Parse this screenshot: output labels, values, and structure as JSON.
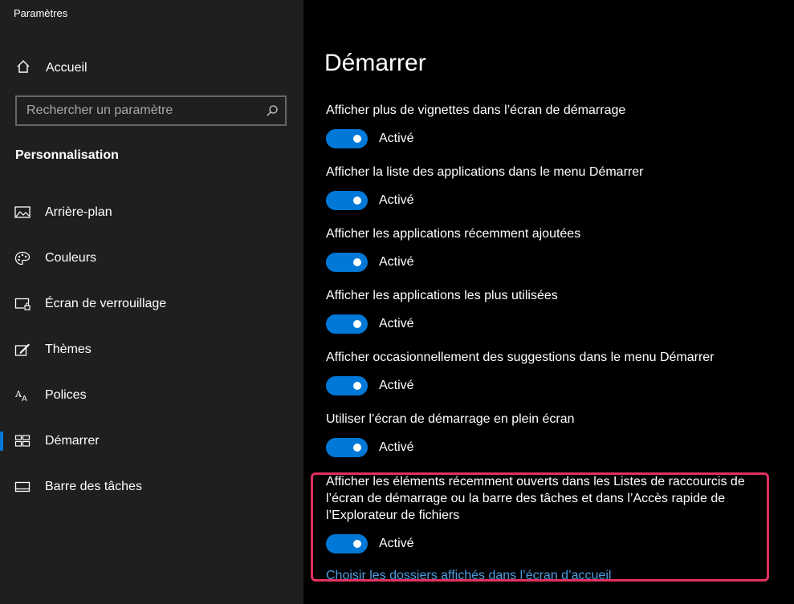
{
  "app": {
    "title": "Paramètres"
  },
  "sidebar": {
    "home_label": "Accueil",
    "search_placeholder": "Rechercher un paramètre",
    "section_title": "Personnalisation",
    "items": [
      {
        "label": "Arrière-plan",
        "icon": "image-icon"
      },
      {
        "label": "Couleurs",
        "icon": "palette-icon"
      },
      {
        "label": "Écran de verrouillage",
        "icon": "lock-screen-icon"
      },
      {
        "label": "Thèmes",
        "icon": "themes-icon"
      },
      {
        "label": "Polices",
        "icon": "fonts-icon"
      },
      {
        "label": "Démarrer",
        "icon": "start-icon",
        "active": true
      },
      {
        "label": "Barre des tâches",
        "icon": "taskbar-icon"
      }
    ]
  },
  "main": {
    "title": "Démarrer",
    "settings": [
      {
        "desc": "Afficher plus de vignettes dans l’écran de démarrage",
        "state": "Activé",
        "on": true
      },
      {
        "desc": "Afficher la liste des applications dans le menu Démarrer",
        "state": "Activé",
        "on": true
      },
      {
        "desc": "Afficher les applications récemment ajoutées",
        "state": "Activé",
        "on": true
      },
      {
        "desc": "Afficher les applications les plus utilisées",
        "state": "Activé",
        "on": true
      },
      {
        "desc": "Afficher occasionnellement des suggestions dans le menu Démarrer",
        "state": "Activé",
        "on": true
      },
      {
        "desc": "Utiliser l’écran de démarrage en plein écran",
        "state": "Activé",
        "on": true
      },
      {
        "desc": "Afficher les éléments récemment ouverts dans les Listes de raccourcis de l’écran de démarrage ou la barre des tâches et dans l’Accès rapide de l’Explorateur de fichiers",
        "state": "Activé",
        "on": true
      }
    ],
    "link": "Choisir les dossiers affichés dans l’écran d’accueil"
  },
  "colors": {
    "accent": "#0078d7",
    "highlight": "#e3305e",
    "link": "#4d9de0"
  }
}
